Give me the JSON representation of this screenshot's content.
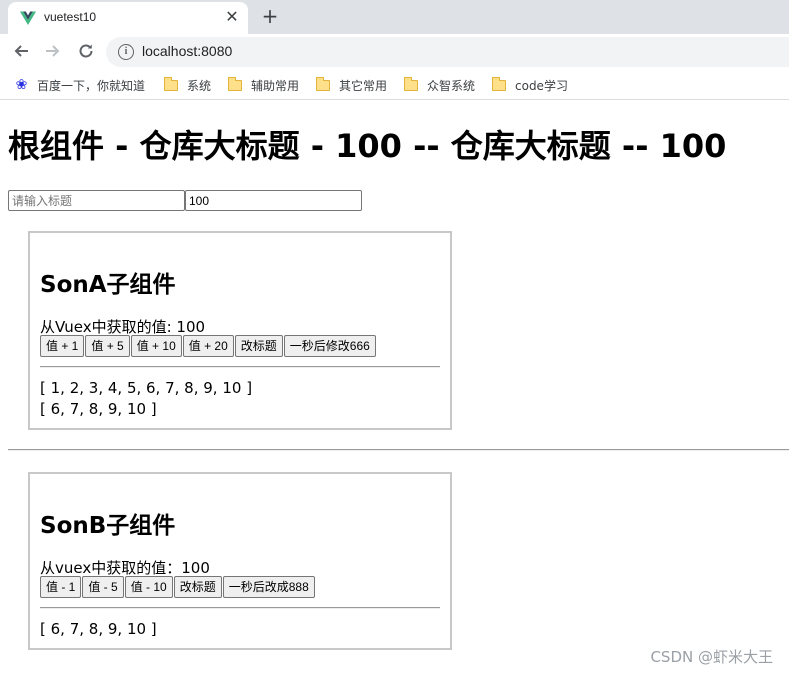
{
  "browser": {
    "tab_title": "vuetest10",
    "tab_close": "✕",
    "new_tab": "+",
    "url": "localhost:8080",
    "bookmarks": [
      {
        "label": "百度一下，你就知道",
        "icon": "baidu-paw-icon"
      },
      {
        "label": "系统",
        "icon": "folder-icon"
      },
      {
        "label": "辅助常用",
        "icon": "folder-icon"
      },
      {
        "label": "其它常用",
        "icon": "folder-icon"
      },
      {
        "label": "众智系统",
        "icon": "folder-icon"
      },
      {
        "label": "code学习",
        "icon": "folder-icon"
      }
    ]
  },
  "root": {
    "title": "根组件 - 仓库大标题 - 100 -- 仓库大标题 -- 100",
    "input_title_placeholder": "请输入标题",
    "input_value": "100"
  },
  "son_a": {
    "title": "SonA子组件",
    "value_text": "从Vuex中获取的值: 100",
    "buttons": [
      "值 + 1",
      "值 + 5",
      "值 + 10",
      "值 + 20",
      "改标题",
      "一秒后修改666"
    ],
    "list_all": "[ 1, 2, 3, 4, 5, 6, 7, 8, 9, 10 ]",
    "list_filtered": "[ 6, 7, 8, 9, 10 ]"
  },
  "son_b": {
    "title": "SonB子组件",
    "value_text": "从vuex中获取的值：100",
    "buttons": [
      "值 - 1",
      "值 - 5",
      "值 - 10",
      "改标题",
      "一秒后改成888"
    ],
    "list_filtered": "[ 6, 7, 8, 9, 10 ]"
  },
  "watermark": "CSDN @虾米大王",
  "colors": {
    "vue_green": "#42b883",
    "vue_dark": "#35495e",
    "baidu_blue": "#2932e1",
    "box_border": "#c8c8c8"
  }
}
